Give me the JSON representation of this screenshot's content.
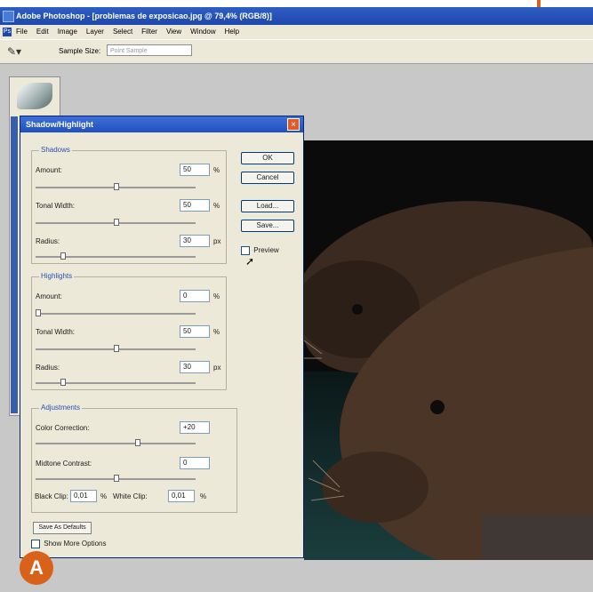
{
  "titlebar": {
    "title": "Adobe Photoshop - [problemas de exposicao.jpg @ 79,4% (RGB/8)]"
  },
  "menubar": {
    "items": [
      "File",
      "Edit",
      "Image",
      "Layer",
      "Select",
      "Filter",
      "View",
      "Window",
      "Help"
    ]
  },
  "options_bar": {
    "sample_size_label": "Sample Size:",
    "sample_size_value": "Point Sample"
  },
  "dialog": {
    "title": "Shadow/Highlight",
    "shadows": {
      "group_label": "Shadows",
      "amount_label": "Amount:",
      "amount_value": "50",
      "amount_unit": "%",
      "tonal_width_label": "Tonal Width:",
      "tonal_width_value": "50",
      "tonal_width_unit": "%",
      "radius_label": "Radius:",
      "radius_value": "30",
      "radius_unit": "px"
    },
    "highlights": {
      "group_label": "Highlights",
      "amount_label": "Amount:",
      "amount_value": "0",
      "amount_unit": "%",
      "tonal_width_label": "Tonal Width:",
      "tonal_width_value": "50",
      "tonal_width_unit": "%",
      "radius_label": "Radius:",
      "radius_value": "30",
      "radius_unit": "px"
    },
    "adjustments": {
      "group_label": "Adjustments",
      "color_correction_label": "Color Correction:",
      "color_correction_value": "+20",
      "midtone_contrast_label": "Midtone Contrast:",
      "midtone_contrast_value": "0",
      "black_clip_label": "Black Clip:",
      "black_clip_value": "0,01",
      "black_clip_unit": "%",
      "white_clip_label": "White Clip:",
      "white_clip_value": "0,01",
      "white_clip_unit": "%"
    },
    "buttons": {
      "ok": "OK",
      "cancel": "Cancel",
      "load": "Load...",
      "save": "Save..."
    },
    "preview_label": "Preview",
    "save_defaults_label": "Save As Defaults",
    "show_more_options_label": "Show More Options"
  },
  "badge": {
    "letter": "A",
    "color": "#d9621b"
  },
  "colors": {
    "accent": "#d9621b",
    "title_blue": "#2150c0",
    "dialog_bg": "#ece9d8"
  }
}
